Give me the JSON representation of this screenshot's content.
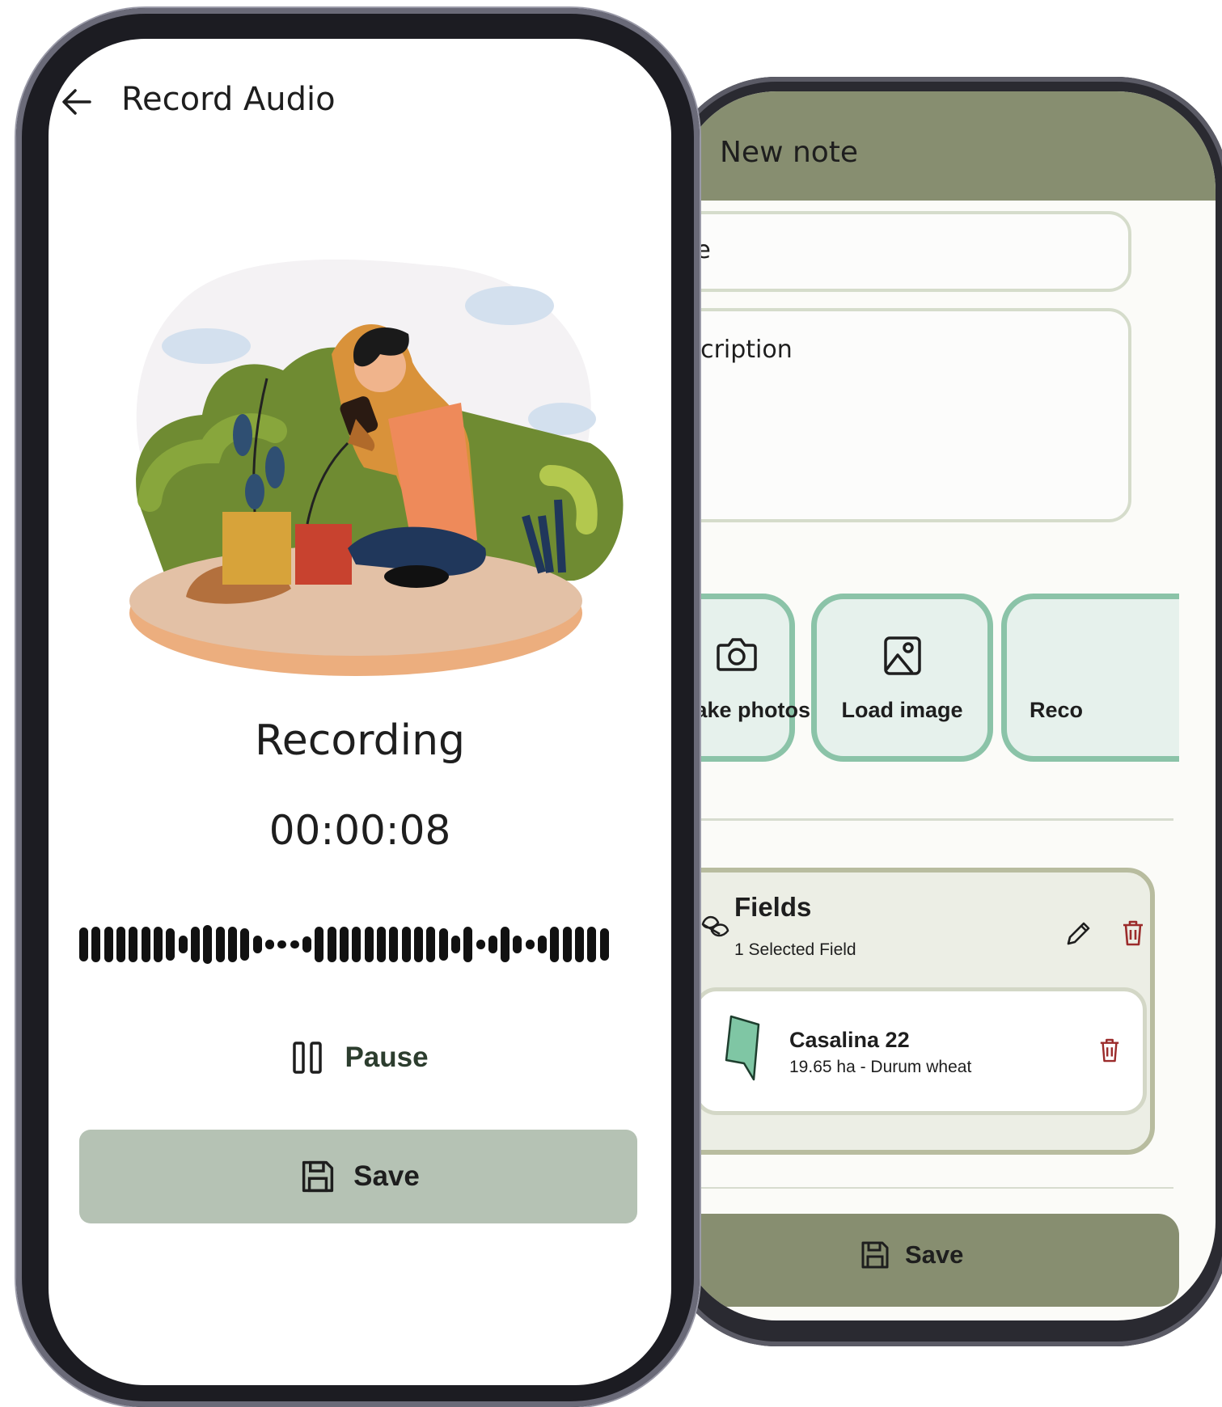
{
  "record_audio": {
    "title": "Record Audio",
    "status": "Recording",
    "timer": "00:00:08",
    "pause_label": "Pause",
    "save_label": "Save"
  },
  "new_note": {
    "title": "New note",
    "title_field_label": "itle",
    "description_field_label": "escription",
    "actions": [
      {
        "label": "Take photos",
        "icon": "camera-icon"
      },
      {
        "label": "Load image",
        "icon": "image-icon"
      },
      {
        "label": "Reco",
        "icon": "microphone-icon"
      }
    ],
    "fields_section": {
      "title": "Fields",
      "subtitle": "1 Selected Field",
      "field": {
        "name": "Casalina 22",
        "meta": "19.65 ha - Durum wheat"
      }
    },
    "save_label": "Save"
  },
  "colors": {
    "header_olive": "#878e70",
    "action_border": "#8bc3a8",
    "record_save_bg": "#b5c2b4",
    "delete_red": "#9b2b2b"
  }
}
